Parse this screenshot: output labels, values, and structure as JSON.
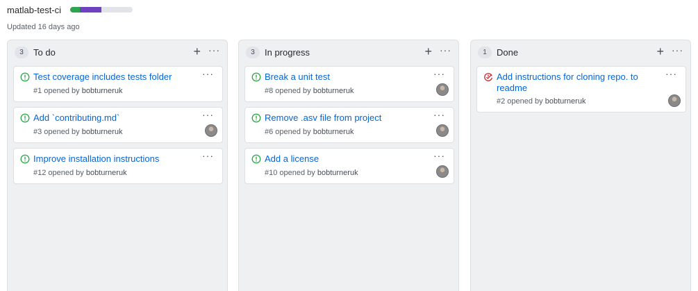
{
  "project": {
    "title": "matlab-test-ci",
    "updated": "Updated 16 days ago",
    "progress": [
      {
        "fraction": 0.15,
        "color": "#2ea44f"
      },
      {
        "fraction": 0.35,
        "color": "#6f42c1"
      },
      {
        "fraction": 0.5,
        "color": "#e1e4e8"
      }
    ]
  },
  "colors": {
    "open": "#28a745",
    "closed": "#cb2431",
    "link": "#0366d6"
  },
  "columns": [
    {
      "count": "3",
      "name": "To do",
      "add_icon": "plus-icon",
      "menu_icon": "kebab-horizontal-icon",
      "cards": [
        {
          "title": "Test coverage includes tests folder",
          "meta_prefix": "#1 opened by ",
          "user": "bobturneruk",
          "state": "open",
          "has_avatar": false
        },
        {
          "title": "Add `contributing.md`",
          "meta_prefix": "#3 opened by ",
          "user": "bobturneruk",
          "state": "open",
          "has_avatar": true
        },
        {
          "title": "Improve installation instructions",
          "meta_prefix": "#12 opened by ",
          "user": "bobturneruk",
          "state": "open",
          "has_avatar": false
        }
      ]
    },
    {
      "count": "3",
      "name": "In progress",
      "add_icon": "plus-icon",
      "menu_icon": "kebab-horizontal-icon",
      "cards": [
        {
          "title": "Break a unit test",
          "meta_prefix": "#8 opened by ",
          "user": "bobturneruk",
          "state": "open",
          "has_avatar": true
        },
        {
          "title": "Remove .asv file from project",
          "meta_prefix": "#6 opened by ",
          "user": "bobturneruk",
          "state": "open",
          "has_avatar": true
        },
        {
          "title": "Add a license",
          "meta_prefix": "#10 opened by ",
          "user": "bobturneruk",
          "state": "open",
          "has_avatar": true
        }
      ]
    },
    {
      "count": "1",
      "name": "Done",
      "add_icon": "plus-icon",
      "menu_icon": "kebab-horizontal-icon",
      "cards": [
        {
          "title": "Add instructions for cloning repo. to readme",
          "meta_prefix": "#2 opened by ",
          "user": "bobturneruk",
          "state": "closed",
          "has_avatar": true
        }
      ]
    }
  ]
}
